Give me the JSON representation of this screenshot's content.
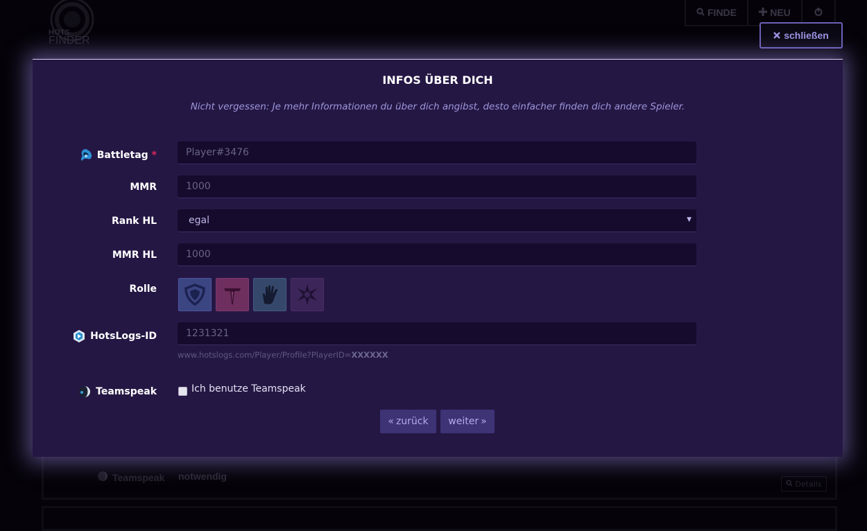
{
  "background": {
    "logo": {
      "line1": "HOTS",
      "line2": "FINDER"
    },
    "nav": {
      "find_label": "FINDE",
      "new_label": "NEU"
    },
    "teamspeak_label": "Teamspeak",
    "teamspeak_value": "notwendig",
    "details_label": "Details"
  },
  "close_button": {
    "label": "schließen",
    "icon": "times-icon"
  },
  "modal": {
    "title": "INFOS ÜBER DICH",
    "subtitle": "Nicht vergessen: Je mehr Informationen du über dich angibst, desto einfacher finden dich andere Spieler.",
    "fields": {
      "battletag": {
        "label": "Battletag",
        "required_mark": "*",
        "placeholder": "Player#3476",
        "icon": "battlenet-icon"
      },
      "mmr": {
        "label": "MMR",
        "placeholder": "1000"
      },
      "rank_hl": {
        "label": "Rank HL",
        "selected": "egal"
      },
      "mmr_hl": {
        "label": "MMR HL",
        "placeholder": "1000"
      },
      "role": {
        "label": "Rolle",
        "options": [
          {
            "name": "Tank",
            "icon": "shield-icon",
            "color": "#3b4582"
          },
          {
            "name": "Assassin",
            "icon": "sword-icon",
            "color": "#6e2e5e"
          },
          {
            "name": "Support",
            "icon": "hand-icon",
            "color": "#35486c"
          },
          {
            "name": "Specialist",
            "icon": "star-icon",
            "color": "#3c2558"
          }
        ]
      },
      "hotslogs_id": {
        "label": "HotsLogs-ID",
        "placeholder": "1231321",
        "help_prefix": "www.hotslogs.com/Player/Profile?PlayerID=",
        "help_bold": "XXXXXX",
        "icon": "hotslogs-icon"
      },
      "teamspeak": {
        "label": "Teamspeak",
        "checkbox_label": "Ich benutze Teamspeak",
        "checked": false,
        "icon": "teamspeak-icon"
      }
    },
    "buttons": {
      "back": "zurück",
      "next": "weiter"
    }
  },
  "colors": {
    "modal_bg": "#251744",
    "input_bg": "#160b2d",
    "accent": "#6b62b8",
    "required": "#e0245e"
  }
}
